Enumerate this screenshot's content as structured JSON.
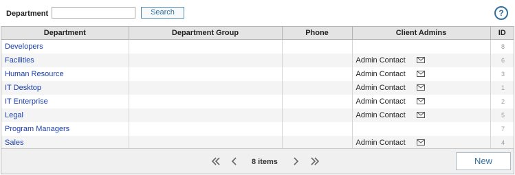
{
  "filter": {
    "label": "Department",
    "input_value": "",
    "input_placeholder": "",
    "search_label": "Search"
  },
  "help": {
    "label": "?"
  },
  "table": {
    "columns": [
      "Department",
      "Department Group",
      "Phone",
      "Client Admins",
      "ID"
    ],
    "rows": [
      {
        "department": "Developers",
        "group": "",
        "phone": "",
        "admin": "",
        "id": "8"
      },
      {
        "department": "Facilities",
        "group": "",
        "phone": "",
        "admin": "Admin Contact",
        "id": "6"
      },
      {
        "department": "Human Resource",
        "group": "",
        "phone": "",
        "admin": "Admin Contact",
        "id": "3"
      },
      {
        "department": "IT Desktop",
        "group": "",
        "phone": "",
        "admin": "Admin Contact",
        "id": "1"
      },
      {
        "department": "IT Enterprise",
        "group": "",
        "phone": "",
        "admin": "Admin Contact",
        "id": "2"
      },
      {
        "department": "Legal",
        "group": "",
        "phone": "",
        "admin": "Admin Contact",
        "id": "5"
      },
      {
        "department": "Program Managers",
        "group": "",
        "phone": "",
        "admin": "",
        "id": "7"
      },
      {
        "department": "Sales",
        "group": "",
        "phone": "",
        "admin": "Admin Contact",
        "id": "4"
      }
    ]
  },
  "pager": {
    "items_label": "8 items",
    "new_label": "New"
  },
  "icons": {
    "mail": "envelope-icon",
    "first": "double-chevron-left-icon",
    "prev": "chevron-left-icon",
    "next": "chevron-right-icon",
    "last": "double-chevron-right-icon",
    "help": "question-mark-icon"
  },
  "colors": {
    "link": "#1a3fb3",
    "accent": "#2f6f9f",
    "header_bg": "#e4e4e4",
    "alt_row_bg": "#f4f4f4"
  }
}
